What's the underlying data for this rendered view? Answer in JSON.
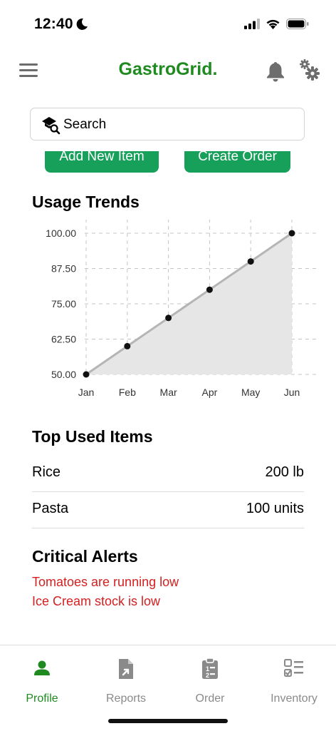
{
  "status_bar": {
    "time": "12:40"
  },
  "header": {
    "title": "GastroGrid."
  },
  "search": {
    "placeholder": "Search"
  },
  "actions": {
    "add_item": "Add New Item",
    "create_order": "Create Order"
  },
  "usage_trends": {
    "title": "Usage Trends"
  },
  "chart_data": {
    "type": "line",
    "categories": [
      "Jan",
      "Feb",
      "Mar",
      "Apr",
      "May",
      "Jun"
    ],
    "values": [
      50,
      60,
      70,
      80,
      90,
      100
    ],
    "ylim": [
      50,
      100
    ],
    "yticks": [
      "100.00",
      "87.50",
      "75.00",
      "62.50",
      "50.00"
    ],
    "title": "",
    "xlabel": "",
    "ylabel": "",
    "grid": true,
    "fill": true,
    "colors": {
      "line": "#b5b5b5",
      "fill": "#e6e6e6",
      "point": "#111111"
    }
  },
  "top_used": {
    "title": "Top Used Items",
    "items": [
      {
        "name": "Rice",
        "qty": "200 lb"
      },
      {
        "name": "Pasta",
        "qty": "100 units"
      }
    ]
  },
  "alerts": {
    "title": "Critical Alerts",
    "items": [
      "Tomatoes are running low",
      "Ice Cream stock is low"
    ]
  },
  "tabs": [
    {
      "label": "Profile",
      "icon": "person-icon",
      "active": true
    },
    {
      "label": "Reports",
      "icon": "report-icon",
      "active": false
    },
    {
      "label": "Order",
      "icon": "clipboard-list-icon",
      "active": false
    },
    {
      "label": "Inventory",
      "icon": "checklist-icon",
      "active": false
    }
  ],
  "colors": {
    "brand": "#1f8a1f",
    "button": "#16a05a",
    "alert": "#d42020",
    "inactive": "#8a8a8a"
  }
}
